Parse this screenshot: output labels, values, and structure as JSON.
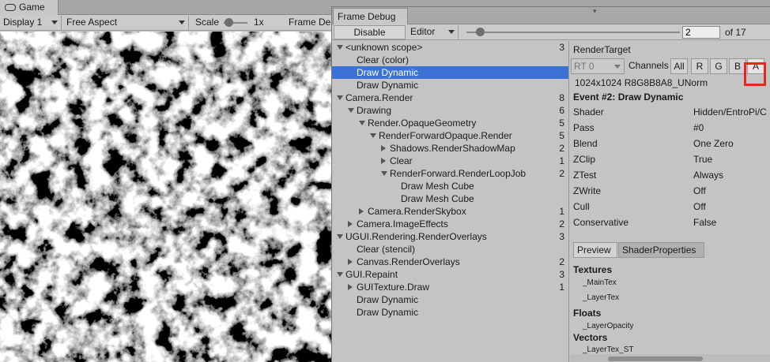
{
  "game": {
    "tab_label": "Game",
    "display": "Display 1",
    "aspect": "Free Aspect",
    "scale_label": "Scale",
    "scale_value": "1x",
    "right_label": "Frame De"
  },
  "frame_debug": {
    "tab_label": "Frame Debug",
    "disable_label": "Disable",
    "mode": "Editor",
    "current_event": "2",
    "total_label": "of 17",
    "tree": [
      {
        "label": "<unknown scope>",
        "depth": 0,
        "arrow": "down",
        "count": "3"
      },
      {
        "label": "Clear (color)",
        "depth": 1,
        "arrow": "",
        "count": ""
      },
      {
        "label": "Draw Dynamic",
        "depth": 1,
        "arrow": "",
        "count": "",
        "selected": true
      },
      {
        "label": "Draw Dynamic",
        "depth": 1,
        "arrow": "",
        "count": ""
      },
      {
        "label": "Camera.Render",
        "depth": 0,
        "arrow": "down",
        "count": "8"
      },
      {
        "label": "Drawing",
        "depth": 1,
        "arrow": "down",
        "count": "6"
      },
      {
        "label": "Render.OpaqueGeometry",
        "depth": 2,
        "arrow": "down",
        "count": "5"
      },
      {
        "label": "RenderForwardOpaque.Render",
        "depth": 3,
        "arrow": "down",
        "count": "5"
      },
      {
        "label": "Shadows.RenderShadowMap",
        "depth": 4,
        "arrow": "right",
        "count": "2"
      },
      {
        "label": "Clear",
        "depth": 4,
        "arrow": "right",
        "count": "1"
      },
      {
        "label": "RenderForward.RenderLoopJob",
        "depth": 4,
        "arrow": "down",
        "count": "2"
      },
      {
        "label": "Draw Mesh Cube",
        "depth": 5,
        "arrow": "",
        "count": ""
      },
      {
        "label": "Draw Mesh Cube",
        "depth": 5,
        "arrow": "",
        "count": ""
      },
      {
        "label": "Camera.RenderSkybox",
        "depth": 2,
        "arrow": "right",
        "count": "1"
      },
      {
        "label": "Camera.ImageEffects",
        "depth": 1,
        "arrow": "right",
        "count": "2"
      },
      {
        "label": "UGUI.Rendering.RenderOverlays",
        "depth": 0,
        "arrow": "down",
        "count": "3"
      },
      {
        "label": "Clear (stencil)",
        "depth": 1,
        "arrow": "",
        "count": ""
      },
      {
        "label": "Canvas.RenderOverlays",
        "depth": 1,
        "arrow": "right",
        "count": "2"
      },
      {
        "label": "GUI.Repaint",
        "depth": 0,
        "arrow": "down",
        "count": "3"
      },
      {
        "label": "GUITexture.Draw",
        "depth": 1,
        "arrow": "right",
        "count": "1"
      },
      {
        "label": "Draw Dynamic",
        "depth": 1,
        "arrow": "",
        "count": ""
      },
      {
        "label": "Draw Dynamic",
        "depth": 1,
        "arrow": "",
        "count": ""
      }
    ],
    "detail": {
      "render_target_title": "RenderTarget",
      "rt_select": "RT 0",
      "channels_label": "Channels",
      "channel_all": "All",
      "channel_r": "R",
      "channel_g": "G",
      "channel_b": "B",
      "channel_a": "A",
      "format": "1024x1024 R8G8B8A8_UNorm",
      "event_title": "Event #2: Draw Dynamic",
      "properties": [
        {
          "key": "Shader",
          "value": "Hidden/EntroPi/C"
        },
        {
          "key": "Pass",
          "value": "#0"
        },
        {
          "key": "Blend",
          "value": "One Zero"
        },
        {
          "key": "ZClip",
          "value": "True"
        },
        {
          "key": "ZTest",
          "value": "Always"
        },
        {
          "key": "ZWrite",
          "value": "Off"
        },
        {
          "key": "Cull",
          "value": "Off"
        },
        {
          "key": "Conservative",
          "value": "False"
        }
      ],
      "tab_preview": "Preview",
      "tab_shader_props": "ShaderProperties",
      "textures_title": "Textures",
      "textures": [
        "_MainTex",
        "_LayerTex"
      ],
      "floats_title": "Floats",
      "floats": [
        "_LayerOpacity"
      ],
      "vectors_title": "Vectors",
      "vectors": [
        "_LayerTex_ST"
      ]
    }
  },
  "colors": {
    "selection": "#3a72d6",
    "highlight_box": "#e8261c"
  }
}
